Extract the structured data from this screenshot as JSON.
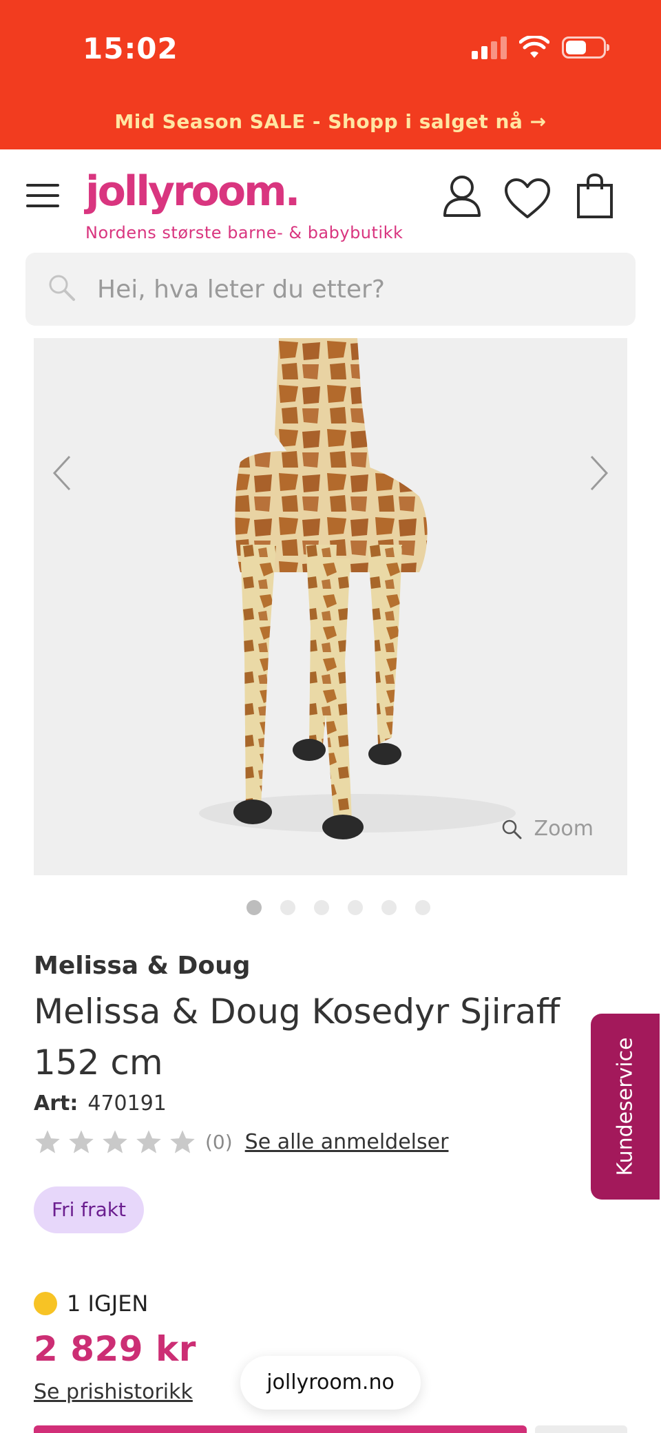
{
  "status_bar": {
    "time": "15:02",
    "battery_level": 0.55,
    "icons": [
      "signal-icon",
      "wifi-icon",
      "battery-icon"
    ]
  },
  "promo_banner": {
    "text": "Mid Season SALE - Shopp i salget nå →"
  },
  "header": {
    "logo": "jollyroom.",
    "tagline": "Nordens største barne- & babybutikk",
    "icons": [
      "menu-icon",
      "account-icon",
      "heart-icon",
      "shopping-bag-icon"
    ]
  },
  "search": {
    "placeholder": "Hei, hva leter du etter?"
  },
  "gallery": {
    "zoom_label": "Zoom",
    "image_count": 6,
    "active_index": 0
  },
  "product": {
    "brand": "Melissa & Doug",
    "title": "Melissa & Doug Kosedyr Sjiraff 152 cm",
    "art_label": "Art:",
    "art_number": "470191",
    "rating": 0,
    "review_count": "(0)",
    "reviews_link": "Se alle anmeldelser",
    "badge": "Fri frakt",
    "stock": "1 IGJEN",
    "price": "2 829 kr",
    "price_history_link": "Se prishistorikk"
  },
  "browser": {
    "url": "jollyroom.no"
  },
  "customer_service": {
    "label": "Kundeservice"
  },
  "colors": {
    "banner": "#f23c1f",
    "brand_pink": "#d9357f",
    "price": "#cc2e74",
    "badge_bg": "#e7d7fa",
    "stock_dot": "#f7c325",
    "service_tab": "#a3195b"
  }
}
